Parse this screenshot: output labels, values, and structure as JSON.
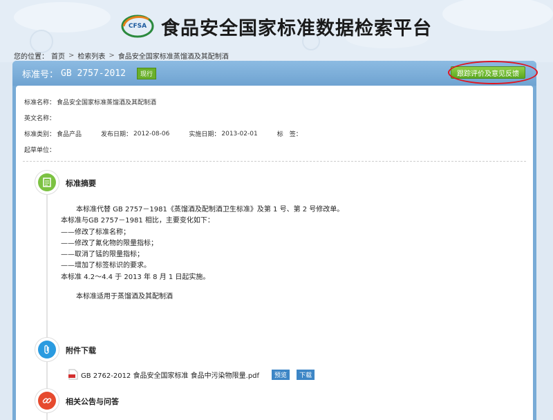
{
  "header": {
    "logo_text": "CFSA",
    "site_title": "食品安全国家标准数据检索平台"
  },
  "breadcrumb": {
    "prefix": "您的位置：",
    "items": [
      "首页",
      "检索列表",
      "食品安全国家标准蒸馏酒及其配制酒"
    ],
    "separator": ">"
  },
  "panel": {
    "std_no_label": "标准号：",
    "std_no": "GB 2757-2012",
    "status": "现行",
    "feedback_button": "跟踪评价及意见反馈"
  },
  "meta": {
    "name_label": "标准名称：",
    "name_value": "食品安全国家标准蒸馏酒及其配制酒",
    "en_label": "英文名称：",
    "en_value": "",
    "category_label": "标准类别：",
    "category_value": "食品产品",
    "publish_label": "发布日期：",
    "publish_value": "2012-08-06",
    "impl_label": "实施日期：",
    "impl_value": "2013-02-01",
    "tag_label": "标　签：",
    "drafter_label": "起草单位："
  },
  "sections": {
    "abstract_title": "标准摘要",
    "download_title": "附件下载",
    "related_title": "相关公告与问答"
  },
  "abstract": {
    "lines": [
      "本标准代替 GB 2757－1981《蒸馏酒及配制酒卫生标准》及第 1 号、第 2 号修改单。",
      "本标准与GB 2757－1981 相比，主要变化如下：",
      "——修改了标准名称；",
      "——修改了氰化物的限量指标；",
      "——取消了锰的限量指标；",
      "——增加了标签标识的要求。",
      "本标准 4.2～4.4 于 2013 年 8 月 1 日起实施。"
    ],
    "scope": "本标准适用于蒸馏酒及其配制酒"
  },
  "download": {
    "file_name": "GB 2762-2012 食品安全国家标准 食品中污染物限量.pdf",
    "preview_label": "预览",
    "download_label": "下载"
  },
  "colors": {
    "panel": "#78abd6",
    "green": "#6ab02b",
    "blue_btn": "#3d86c6",
    "highlight": "#e0141e"
  }
}
